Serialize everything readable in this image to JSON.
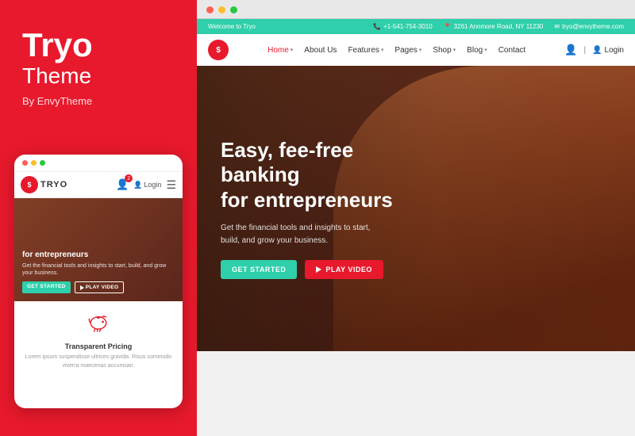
{
  "left": {
    "brand": {
      "title": "Tryo",
      "subtitle": "Theme",
      "by": "By EnvyTheme"
    },
    "mobile": {
      "dots": [
        "red",
        "yellow",
        "green"
      ],
      "logo_text": "TRYO",
      "login_label": "Login",
      "badge_count": "2",
      "hero_title": "for entrepreneurs",
      "hero_sub": "Get the financial tools and insights to start, build, and\ngrow your business.",
      "btn_start": "GET STARTED",
      "btn_play": "PLAY VIDEO",
      "feature_icon": "piggy-bank",
      "feature_title": "Transparent Pricing",
      "feature_text": "Lorem ipsum suspendisse ultrices gravida. Risus commodo viverra maecenas accumsan."
    }
  },
  "right": {
    "browser": {
      "dots": [
        "red",
        "yellow",
        "green"
      ]
    },
    "topbar": {
      "welcome": "Welcome to Tryo",
      "phone": "+1-541-754-3010",
      "address": "3261 Annmore Road, NY 11230",
      "email": "tryo@envytheme.com"
    },
    "nav": {
      "logo_text": "$",
      "links": [
        {
          "label": "Home",
          "active": true,
          "has_dropdown": true
        },
        {
          "label": "About Us",
          "active": false,
          "has_dropdown": false
        },
        {
          "label": "Features",
          "active": false,
          "has_dropdown": true
        },
        {
          "label": "Pages",
          "active": false,
          "has_dropdown": true
        },
        {
          "label": "Shop",
          "active": false,
          "has_dropdown": true
        },
        {
          "label": "Blog",
          "active": false,
          "has_dropdown": true
        },
        {
          "label": "Contact",
          "active": false,
          "has_dropdown": false
        }
      ],
      "login_label": "Login"
    },
    "hero": {
      "title": "Easy, fee-free banking\nfor entrepreneurs",
      "subtitle": "Get the financial tools and insights to start,\nbuild, and grow your business.",
      "btn_start": "GET STARTED",
      "btn_play": "PLAY VIDEO"
    }
  }
}
